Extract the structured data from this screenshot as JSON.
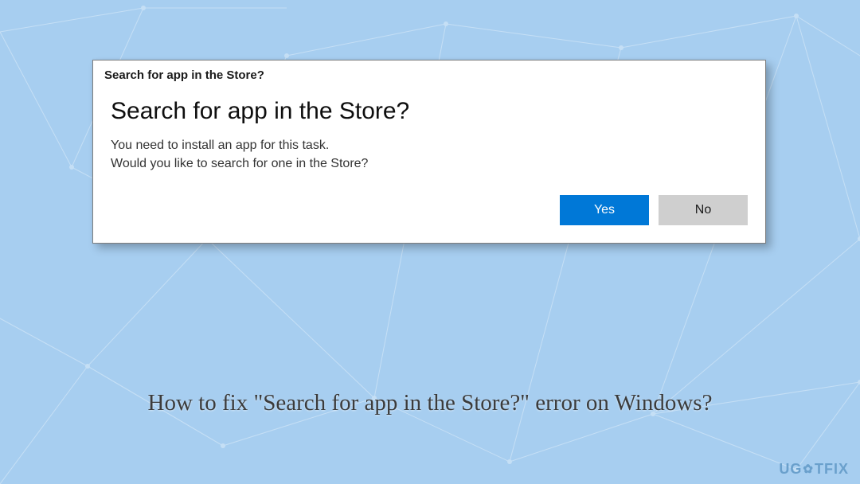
{
  "dialog": {
    "title": "Search for app in the Store?",
    "heading": "Search for app in the Store?",
    "body_line1": "You need to install an app for this task.",
    "body_line2": "Would you like to search for one in the Store?",
    "yes_label": "Yes",
    "no_label": "No"
  },
  "caption": "How to fix \"Search for app in the Store?\" error on Windows?",
  "watermark": {
    "part1": "UG",
    "part2": "TFIX"
  }
}
